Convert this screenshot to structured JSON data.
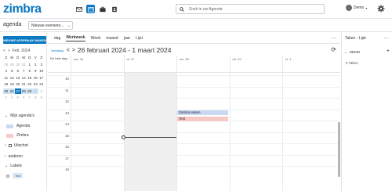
{
  "header": {
    "logo": "zimbra",
    "search_placeholder": "Zoek in uw Agenda",
    "username": "Demo"
  },
  "app_bar": {
    "app_label": "agenda",
    "new_dropdown": "Nieuwe evenene..."
  },
  "sidebar": {
    "new_appointment_label": "NIEUWE AFSPRAAK MAKEN",
    "mini_cal": {
      "month_label": "Feb. 2024",
      "weekday_headers": [
        "Z",
        "M",
        "D",
        "W",
        "D",
        "V",
        "Z"
      ],
      "weeks": [
        [
          {
            "d": "28",
            "dim": true
          },
          {
            "d": "29",
            "dim": true
          },
          {
            "d": "30",
            "dim": true
          },
          {
            "d": "31",
            "dim": true
          },
          {
            "d": "1"
          },
          {
            "d": "2"
          },
          {
            "d": "3"
          }
        ],
        [
          {
            "d": "4"
          },
          {
            "d": "5"
          },
          {
            "d": "6"
          },
          {
            "d": "7"
          },
          {
            "d": "8"
          },
          {
            "d": "9"
          },
          {
            "d": "10"
          }
        ],
        [
          {
            "d": "11"
          },
          {
            "d": "12"
          },
          {
            "d": "13"
          },
          {
            "d": "14"
          },
          {
            "d": "15"
          },
          {
            "d": "16"
          },
          {
            "d": "17"
          }
        ],
        [
          {
            "d": "18"
          },
          {
            "d": "19"
          },
          {
            "d": "20"
          },
          {
            "d": "21"
          },
          {
            "d": "22"
          },
          {
            "d": "23"
          },
          {
            "d": "24"
          }
        ],
        [
          {
            "d": "25",
            "wk": true
          },
          {
            "d": "26",
            "wk": true
          },
          {
            "d": "27",
            "today": true
          },
          {
            "d": "28",
            "wk": true
          },
          {
            "d": "29",
            "wk": true
          },
          {
            "d": "1",
            "wk": true,
            "dim": true
          },
          {
            "d": "2",
            "dim": true
          }
        ],
        [
          {
            "d": "3",
            "dim": true
          },
          {
            "d": "4",
            "dim": true
          },
          {
            "d": "5",
            "dim": true
          },
          {
            "d": "6",
            "dim": true
          },
          {
            "d": "7",
            "dim": true
          },
          {
            "d": "8",
            "dim": true
          },
          {
            "d": "9",
            "dim": true
          }
        ]
      ]
    },
    "my_agendas_label": "Mijn agenda's",
    "agenda_items": [
      {
        "label": "Agenda",
        "color": "#c9d9f2"
      },
      {
        "label": "Zimbra",
        "color": "#f6c9c7"
      }
    ],
    "shared_label": "Uitschot",
    "others_label": "anderen",
    "labels_label": "Labels",
    "tag_label": "Test"
  },
  "views": [
    "dag",
    "Werkweek",
    "Week",
    "maand",
    "jaar",
    "Lijst"
  ],
  "active_view": "Werkweek",
  "toolbar": {
    "today_label": "Vandaag",
    "range_title": "26 februari 2024 - 1 maart 2024"
  },
  "all_day_label": "De hele dag",
  "days": [
    "ma. 26",
    "di. 27",
    "wo. 28",
    "do. 29",
    "vr. 1"
  ],
  "hours": [
    "10",
    "11",
    "12",
    "13",
    "14",
    "15",
    "16",
    "17",
    "18"
  ],
  "events": [
    {
      "title": "Zimbra testen",
      "day": "wo. 28",
      "start": "13:30",
      "end": "14:00",
      "color": "#c9d9f2"
    },
    {
      "title": "Test",
      "day": "wo. 28",
      "start": "14:00",
      "end": "14:30",
      "color": "#f6c9c7"
    }
  ],
  "tasks": {
    "title": "Taken - Lijst",
    "group_label": "DEMO",
    "count_label": "0 Taken"
  }
}
